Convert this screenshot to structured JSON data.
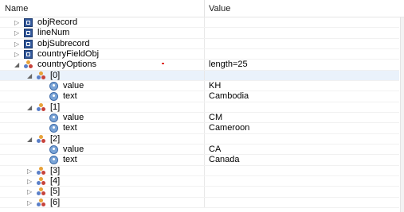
{
  "header": {
    "name_col": "Name",
    "value_col": "Value"
  },
  "rows": [
    {
      "name": "objRecord",
      "value": "",
      "expander": "collapsed",
      "icon": "object-icon",
      "depth": 0
    },
    {
      "name": "lineNum",
      "value": "",
      "expander": "collapsed",
      "icon": "object-icon",
      "depth": 0
    },
    {
      "name": "objSubrecord",
      "value": "",
      "expander": "collapsed",
      "icon": "object-icon",
      "depth": 0
    },
    {
      "name": "countryFieldObj",
      "value": "",
      "expander": "collapsed",
      "icon": "object-icon",
      "depth": 0
    },
    {
      "name": "countryOptions",
      "value": "length=25",
      "expander": "expanded",
      "icon": "array-icon",
      "depth": 0
    },
    {
      "name": "[0]",
      "value": "",
      "expander": "expanded",
      "icon": "array-icon",
      "depth": 1
    },
    {
      "name": "value",
      "value": "KH",
      "expander": "none",
      "icon": "field-icon",
      "depth": 2
    },
    {
      "name": "text",
      "value": "Cambodia",
      "expander": "none",
      "icon": "field-icon",
      "depth": 2
    },
    {
      "name": "[1]",
      "value": "",
      "expander": "expanded",
      "icon": "array-icon",
      "depth": 1
    },
    {
      "name": "value",
      "value": "CM",
      "expander": "none",
      "icon": "field-icon",
      "depth": 2
    },
    {
      "name": "text",
      "value": "Cameroon",
      "expander": "none",
      "icon": "field-icon",
      "depth": 2
    },
    {
      "name": "[2]",
      "value": "",
      "expander": "expanded",
      "icon": "array-icon",
      "depth": 1
    },
    {
      "name": "value",
      "value": "CA",
      "expander": "none",
      "icon": "field-icon",
      "depth": 2
    },
    {
      "name": "text",
      "value": "Canada",
      "expander": "none",
      "icon": "field-icon",
      "depth": 2
    },
    {
      "name": "[3]",
      "value": "",
      "expander": "collapsed",
      "icon": "array-icon",
      "depth": 1
    },
    {
      "name": "[4]",
      "value": "",
      "expander": "collapsed",
      "icon": "array-icon",
      "depth": 1
    },
    {
      "name": "[5]",
      "value": "",
      "expander": "collapsed",
      "icon": "array-icon",
      "depth": 1
    },
    {
      "name": "[6]",
      "value": "",
      "expander": "collapsed",
      "icon": "array-icon",
      "depth": 1
    }
  ],
  "selected_row": 5,
  "colors": {
    "selection": "#eaf2fb",
    "object_icon": "#31579a",
    "field_icon": "#7aa4d6"
  }
}
